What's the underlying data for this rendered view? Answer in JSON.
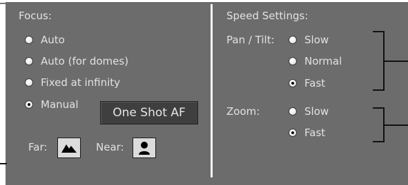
{
  "focus": {
    "title": "Focus:",
    "options": [
      {
        "label": "Auto",
        "selected": false
      },
      {
        "label": "Auto (for domes)",
        "selected": false
      },
      {
        "label": "Fixed at infinity",
        "selected": false
      },
      {
        "label": "Manual",
        "selected": true
      }
    ],
    "one_shot_label": "One Shot AF",
    "far_label": "Far:",
    "near_label": "Near:",
    "far_icon": "mountain-icon",
    "near_icon": "person-icon"
  },
  "speed": {
    "title": "Speed Settings:",
    "pan_tilt_label": "Pan / Tilt:",
    "pan_tilt_options": [
      {
        "label": "Slow",
        "selected": false
      },
      {
        "label": "Normal",
        "selected": false
      },
      {
        "label": "Fast",
        "selected": true
      }
    ],
    "zoom_label": "Zoom:",
    "zoom_options": [
      {
        "label": "Slow",
        "selected": false
      },
      {
        "label": "Fast",
        "selected": true
      }
    ]
  },
  "colors": {
    "panel": "#6c6c6c",
    "text": "#e2e2e2",
    "button": "#3f3f3f"
  }
}
